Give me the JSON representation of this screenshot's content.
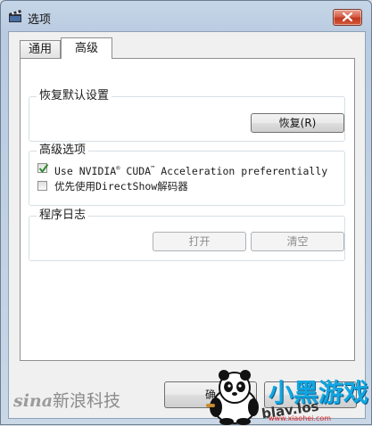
{
  "window": {
    "title": "选项",
    "icon": "film-clapper-icon"
  },
  "tabs": [
    {
      "label": "通用",
      "active": false
    },
    {
      "label": "高级",
      "active": true
    }
  ],
  "restore_group": {
    "title": "恢复默认设置",
    "button_label": "恢复(R)"
  },
  "advanced_group": {
    "title": "高级选项",
    "options": [
      {
        "label_prefix": "Use NVIDIA",
        "label_reg": "®",
        "label_mid": " CUDA",
        "label_tm": "™",
        "label_suffix": " Acceleration preferentially",
        "checked": true
      },
      {
        "label": "优先使用DirectShow解码器",
        "checked": false
      }
    ]
  },
  "log_group": {
    "title": "程序日志",
    "open_label": "打开",
    "clear_label": "清空"
  },
  "footer": {
    "ok_label": "确"
  },
  "watermarks": {
    "sina_en": "sina",
    "sina_cn": "新浪科技",
    "url": "blav.los",
    "site_name": "小黑游戏",
    "site_url": "www.xiaohei.com"
  },
  "colors": {
    "accent_check": "#2d8a2d",
    "close_button": "#c7452b"
  }
}
